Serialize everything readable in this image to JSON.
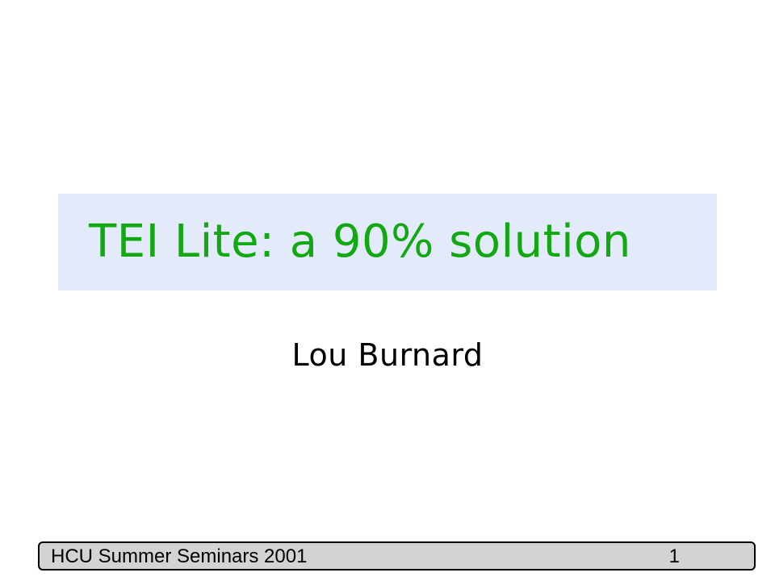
{
  "slide": {
    "title": "TEI Lite: a 90% solution",
    "author": "Lou Burnard",
    "footer": {
      "event": "HCU Summer Seminars 2001",
      "page_number": "1"
    }
  },
  "colors": {
    "title_text": "#12a812",
    "title_background": "#e3ebfa",
    "footer_background": "#d3d3d3"
  }
}
